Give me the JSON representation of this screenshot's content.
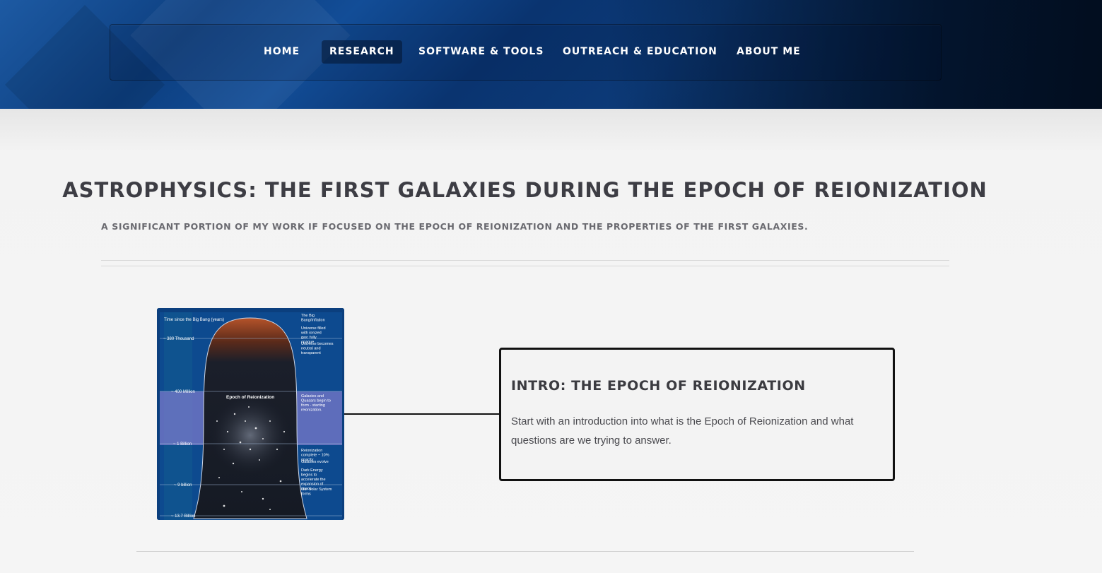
{
  "nav": {
    "items": [
      {
        "label": "HOME"
      },
      {
        "label": "RESEARCH",
        "active": true
      },
      {
        "label": "SOFTWARE & TOOLS"
      },
      {
        "label": "OUTREACH & EDUCATION"
      },
      {
        "label": "ABOUT ME"
      }
    ]
  },
  "page": {
    "title": "ASTROPHYSICS: THE FIRST GALAXIES DURING THE EPOCH OF REIONIZATION",
    "subtitle": "A SIGNIFICANT PORTION OF MY WORK IF FOCUSED ON THE EPOCH OF REIONIZATION AND THE PROPERTIES OF THE FIRST GALAXIES."
  },
  "timeline_figure": {
    "axis_label": "Time since the Big Bang (years)",
    "ticks": [
      "~ 380 Thousand",
      "~ 400 Million",
      "~ 1 Billion",
      "~ 9 billion",
      "~ 13.7 Billion"
    ],
    "center_label": "Epoch of Reionization",
    "annotations": [
      "The Big Bang/Inflation",
      "Universe filled with ionized gas: fully opaque",
      "Universe becomes neutral and transparent",
      "Galaxies and Quasars begin to form - starting reionization.",
      "Reionization complete ~ 10% opacity",
      "Galaxies evolve",
      "Dark Energy begins to accelerate the expansion of space",
      "Our Solar System forms"
    ],
    "colors": {
      "background": "#0b3f7e",
      "band": "#7a79c9"
    }
  },
  "card": {
    "title": "INTRO: THE EPOCH OF REIONIZATION",
    "text": "Start with an introduction into what is the Epoch of Reionization and what questions are we trying to answer."
  },
  "colors": {
    "header_blue": "#0d3f80",
    "text_dark": "#3d3d44",
    "text_muted": "#6a6a70"
  }
}
